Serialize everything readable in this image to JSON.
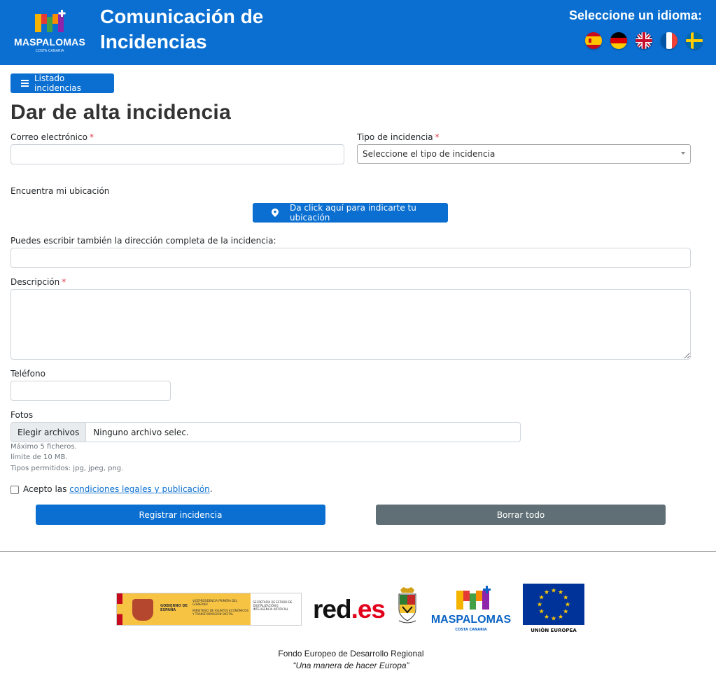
{
  "header": {
    "logo_text": "MASPALOMAS",
    "logo_subtext": "COSTA CANARIA",
    "title": "Comunicación de Incidencias",
    "language_prompt": "Seleccione un idioma:",
    "languages": [
      "Español",
      "Deutsch",
      "English",
      "Français",
      "Svenska"
    ]
  },
  "nav": {
    "list_button": "Listado incidencias"
  },
  "page_title": "Dar de alta incidencia",
  "form": {
    "email_label": "Correo electrónico",
    "email_value": "",
    "type_label": "Tipo de incidencia",
    "type_selected": "Seleccione el tipo de incidencia",
    "required_mark": "*",
    "location_label": "Encuentra mi ubicación",
    "location_button": "Da click aquí para indicarte tu ubicación",
    "address_label": "Puedes escribir también la dirección completa de la incidencia:",
    "address_value": "",
    "description_label": "Descripción",
    "description_value": "",
    "phone_label": "Teléfono",
    "phone_value": "",
    "photos_label": "Fotos",
    "file_button": "Elegir archivos",
    "file_status": "Ninguno archivo selec.",
    "help_max_files": "Máximo 5 ficheros.",
    "help_limit": "límite de 10 MB.",
    "help_types": "Tipos permitidos: jpg, jpeg, png.",
    "accept_prefix": "Acepto las",
    "accept_link": "condiciones legales y publicación",
    "accept_suffix": ".",
    "accept_checked": false,
    "submit_button": "Registrar incidencia",
    "clear_button": "Borrar todo"
  },
  "footer": {
    "gob_lines": [
      "GOBIERNO DE ESPAÑA",
      "VICEPRESIDENCIA PRIMERA DEL GOBIERNO",
      "MINISTERIO DE ASUNTOS ECONÓMICOS Y TRANSFORMACIÓN DIGITAL",
      "SECRETARÍA DE ESTADO DE DIGITALIZACIÓN E INTELIGENCIA ARTIFICIAL"
    ],
    "redes_main": "red",
    "redes_accent": ".es",
    "maspalomas_text": "MASPALOMAS",
    "maspalomas_sub": "COSTA CANARIA",
    "eu_text": "UNIÓN EUROPEA",
    "fund": "Fondo Europeo de Desarrollo Regional",
    "motto": "“Una manera de hacer Europa”"
  },
  "colors": {
    "primary": "#0a6fd1",
    "secondary": "#5f6f75",
    "required": "#dc3545"
  }
}
